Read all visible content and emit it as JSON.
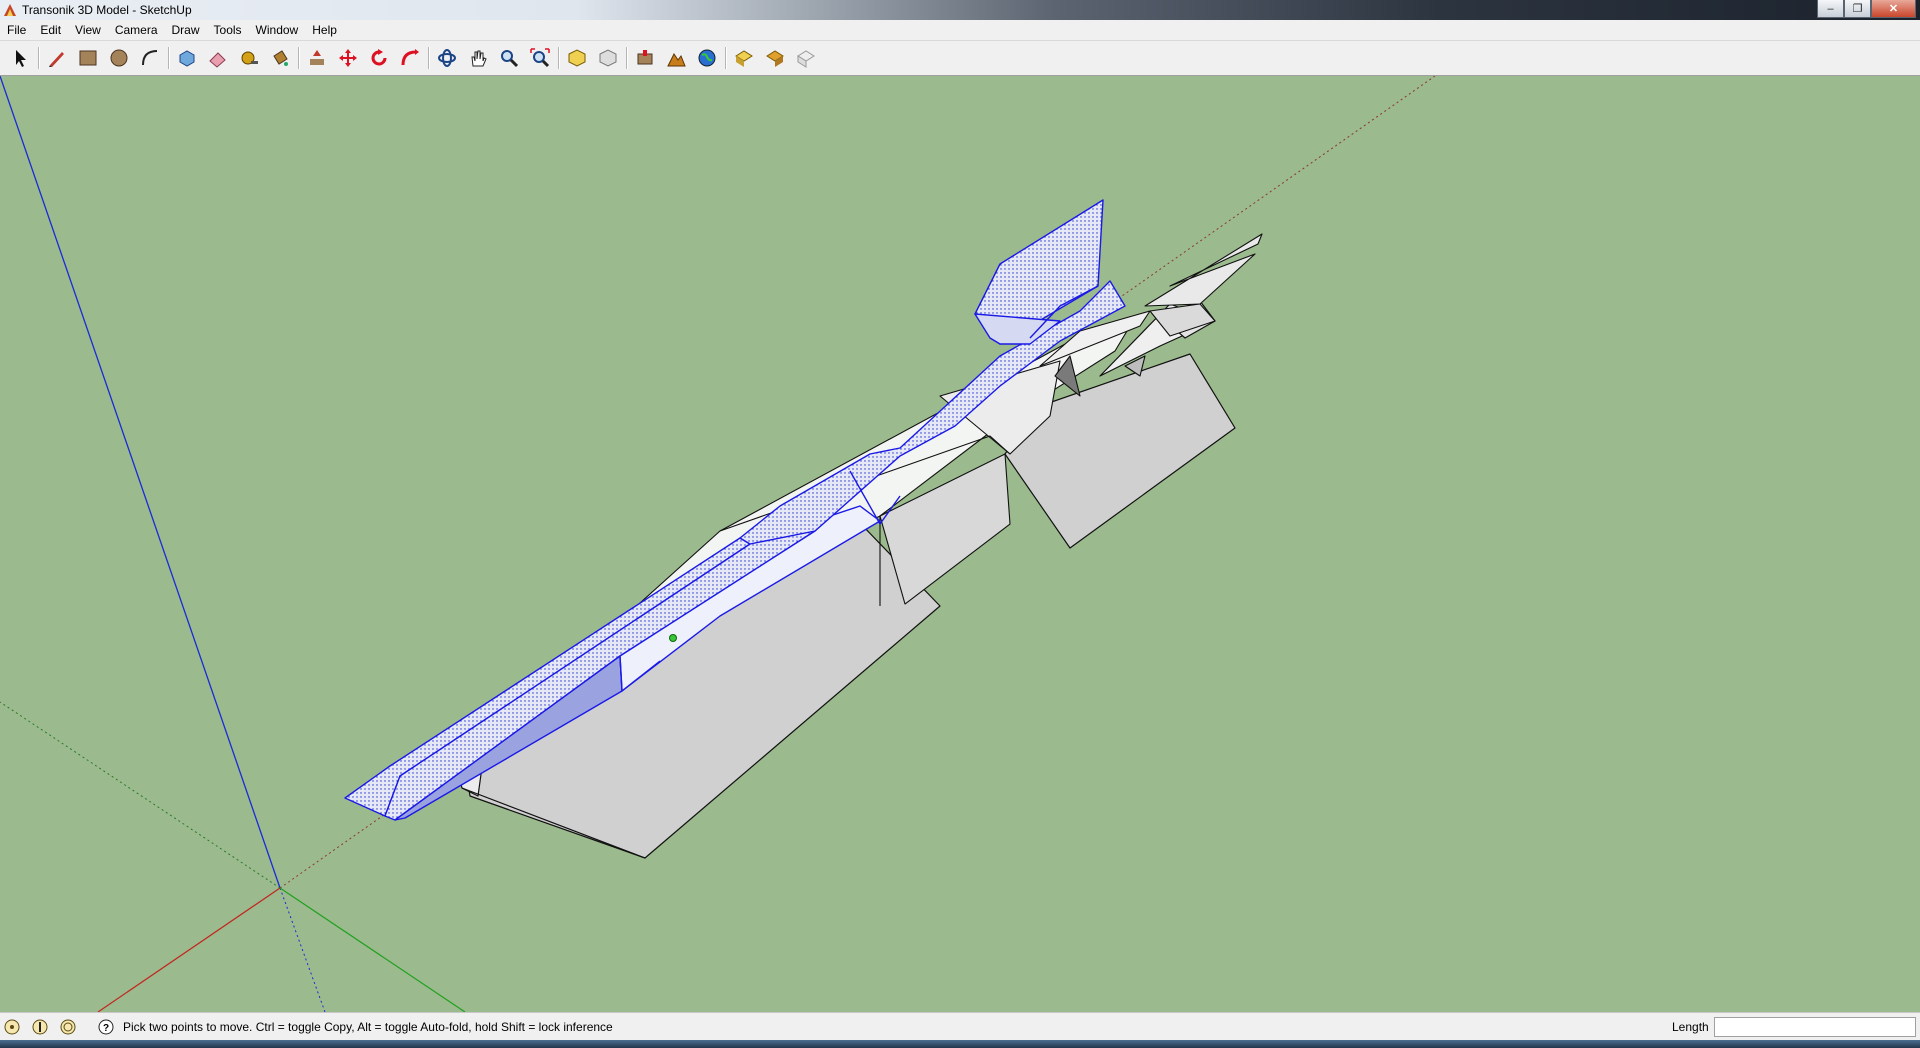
{
  "window": {
    "title": "Transonik 3D Model - SketchUp",
    "controls": [
      "minimize-icon",
      "maximize-icon",
      "close-icon"
    ]
  },
  "menu": [
    "File",
    "Edit",
    "View",
    "Camera",
    "Draw",
    "Tools",
    "Window",
    "Help"
  ],
  "toolbar": {
    "tools": [
      {
        "name": "select-tool",
        "icon": "arrow-cursor-icon"
      },
      {
        "name": "pencil-tool",
        "icon": "pencil-icon"
      },
      {
        "name": "rectangle-tool",
        "icon": "rectangle-icon"
      },
      {
        "name": "circle-tool",
        "icon": "circle-icon"
      },
      {
        "name": "arc-tool",
        "icon": "arc-icon"
      },
      {
        "name": "make-component-tool",
        "icon": "component-icon"
      },
      {
        "name": "eraser-tool",
        "icon": "eraser-icon"
      },
      {
        "name": "tape-measure-tool",
        "icon": "tape-measure-icon"
      },
      {
        "name": "paint-bucket-tool",
        "icon": "paint-bucket-icon"
      },
      {
        "name": "push-pull-tool",
        "icon": "push-pull-icon"
      },
      {
        "name": "move-tool",
        "icon": "move-icon"
      },
      {
        "name": "rotate-tool",
        "icon": "rotate-icon"
      },
      {
        "name": "follow-me-tool",
        "icon": "follow-me-icon"
      },
      {
        "name": "orbit-tool",
        "icon": "orbit-icon"
      },
      {
        "name": "pan-tool",
        "icon": "hand-icon"
      },
      {
        "name": "zoom-tool",
        "icon": "magnifier-icon"
      },
      {
        "name": "zoom-extents-tool",
        "icon": "zoom-extents-icon"
      },
      {
        "name": "get-models-tool",
        "icon": "get-models-icon"
      },
      {
        "name": "share-model-tool",
        "icon": "share-model-icon"
      },
      {
        "name": "add-location-tool",
        "icon": "add-location-icon"
      },
      {
        "name": "toggle-terrain-tool",
        "icon": "terrain-icon"
      },
      {
        "name": "preview-earth-tool",
        "icon": "earth-icon"
      },
      {
        "name": "get-photo-texture-tool",
        "icon": "photo-texture-icon"
      },
      {
        "name": "share-component-tool",
        "icon": "share-component-icon"
      },
      {
        "name": "extension-tool",
        "icon": "extension-icon"
      }
    ]
  },
  "status": {
    "icons": [
      "geo-location-icon",
      "credits-icon",
      "sign-in-icon",
      "help-icon"
    ],
    "message": "Pick two points to move.  Ctrl = toggle Copy, Alt = toggle Auto-fold, hold Shift = lock inference",
    "length_label": "Length",
    "length_value": ""
  },
  "colors": {
    "background": "#9bba8d",
    "selection": "#1a1ae6",
    "model_face": "#f2f4f2",
    "model_shadow": "#d2d2d2"
  }
}
